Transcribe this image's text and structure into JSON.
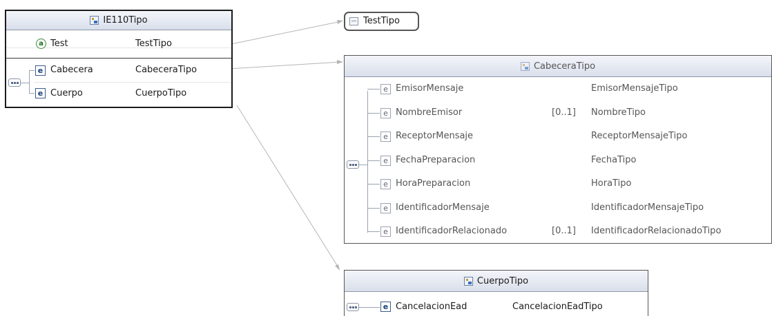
{
  "ie110": {
    "title": "IE110Tipo",
    "rows": [
      {
        "kind": "attribute",
        "name": "Test",
        "type": "TestTipo"
      },
      {
        "kind": "element",
        "name": "Cabecera",
        "type": "CabeceraTipo"
      },
      {
        "kind": "element",
        "name": "Cuerpo",
        "type": "CuerpoTipo"
      }
    ]
  },
  "test_tipo": {
    "title": "TestTipo"
  },
  "cabecera": {
    "title": "CabeceraTipo",
    "rows": [
      {
        "name": "EmisorMensaje",
        "card": "",
        "type": "EmisorMensajeTipo"
      },
      {
        "name": "NombreEmisor",
        "card": "[0..1]",
        "type": "NombreTipo"
      },
      {
        "name": "ReceptorMensaje",
        "card": "",
        "type": "ReceptorMensajeTipo"
      },
      {
        "name": "FechaPreparacion",
        "card": "",
        "type": "FechaTipo"
      },
      {
        "name": "HoraPreparacion",
        "card": "",
        "type": "HoraTipo"
      },
      {
        "name": "IdentificadorMensaje",
        "card": "",
        "type": "IdentificadorMensajeTipo"
      },
      {
        "name": "IdentificadorRelacionado",
        "card": "[0..1]",
        "type": "IdentificadorRelacionadoTipo"
      }
    ]
  },
  "cuerpo": {
    "title": "CuerpoTipo",
    "rows": [
      {
        "name": "CancelacionEad",
        "type": "CancelacionEadTipo"
      }
    ]
  },
  "icons": {
    "element": "e",
    "attribute": "a"
  }
}
